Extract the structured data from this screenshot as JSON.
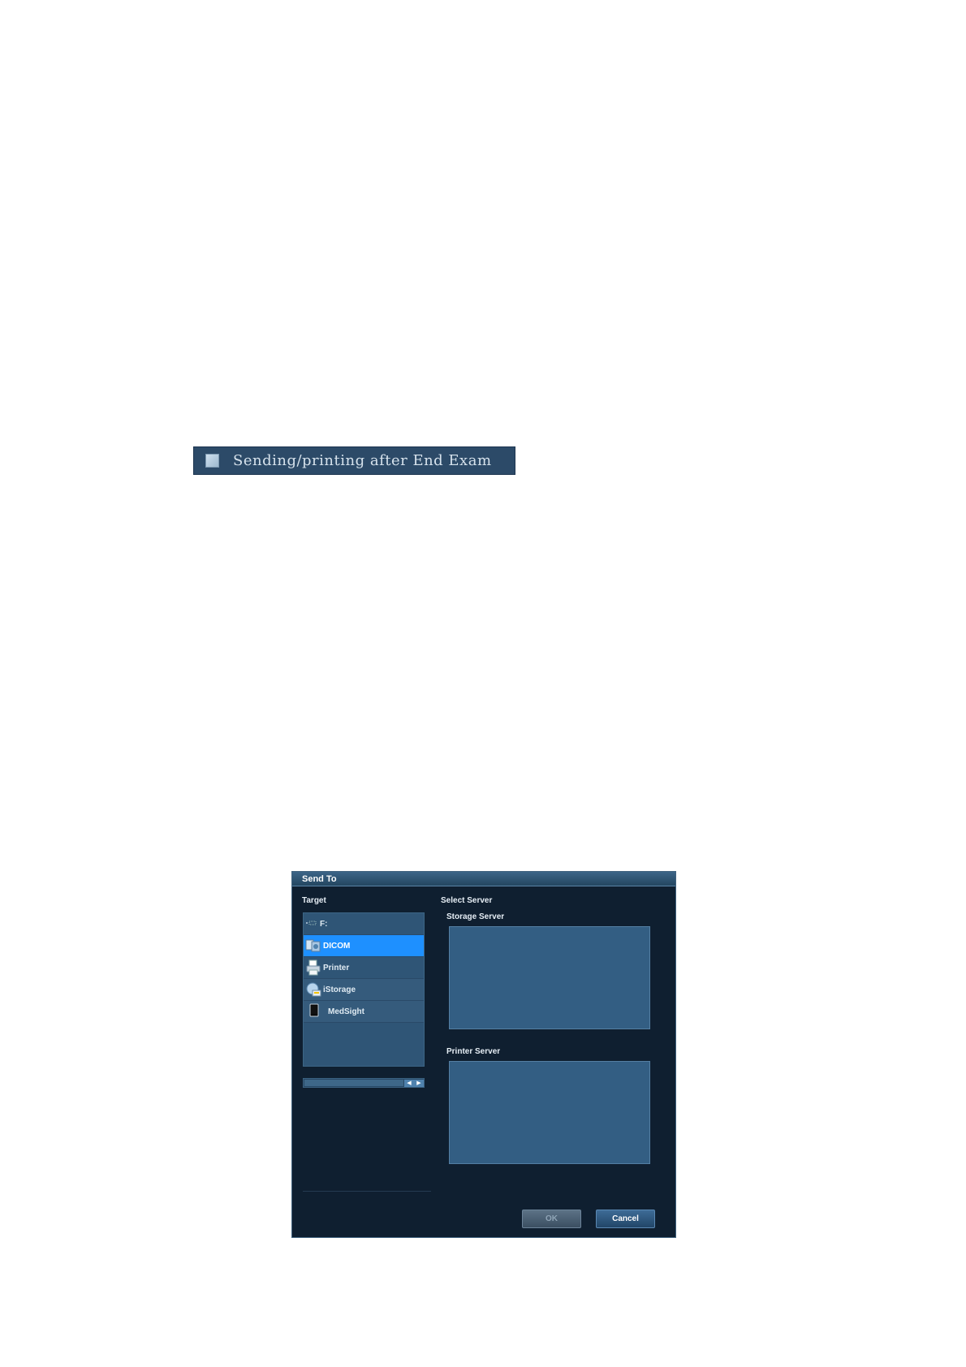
{
  "option": {
    "label": "Sending/printing after End Exam",
    "checked": false
  },
  "dialog": {
    "title": "Send To",
    "target_label": "Target",
    "select_server_label": "Select Server",
    "storage_server_label": "Storage Server",
    "printer_server_label": "Printer Server",
    "targets": [
      {
        "label": "F:",
        "icon": "drive-icon"
      },
      {
        "label": "DICOM",
        "icon": "dicom-icon",
        "selected": true
      },
      {
        "label": "Printer",
        "icon": "printer-icon"
      },
      {
        "label": "iStorage",
        "icon": "istorage-icon"
      },
      {
        "label": "MedSight",
        "icon": "medsight-icon"
      }
    ],
    "ok_label": "OK",
    "cancel_label": "Cancel"
  },
  "colors": {
    "dialog_bg": "#0f1f30",
    "selection": "#1e90ff",
    "panel": "#335e83"
  }
}
